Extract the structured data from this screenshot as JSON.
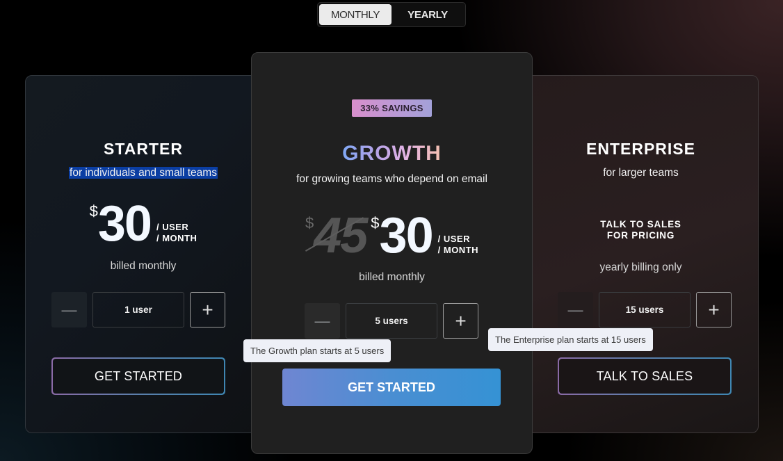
{
  "billing_toggle": {
    "options": [
      {
        "label": "MONTHLY",
        "active": true
      },
      {
        "label": "YEARLY",
        "active": false
      }
    ]
  },
  "plans": {
    "starter": {
      "title": "STARTER",
      "subtitle": "for individuals and small teams",
      "currency": "$",
      "price": "30",
      "per_user": "/ USER",
      "per_month": "/ MONTH",
      "billing": "billed monthly",
      "minus": "—",
      "plus": "+",
      "seats": "1 user",
      "cta": "GET STARTED"
    },
    "growth": {
      "badge": "33% SAVINGS",
      "title": "GROWTH",
      "subtitle": "for growing teams who depend on email",
      "currency": "$",
      "old_price": "45",
      "price": "30",
      "per_user": "/ USER",
      "per_month": "/ MONTH",
      "billing": "billed monthly",
      "minus": "—",
      "plus": "+",
      "seats": "5 users",
      "cta": "GET STARTED",
      "tooltip": "The Growth plan starts at 5 users"
    },
    "enterprise": {
      "title": "ENTERPRISE",
      "subtitle": "for larger teams",
      "pricing_line1": "TALK TO SALES",
      "pricing_line2": "FOR PRICING",
      "billing": "yearly billing only",
      "minus": "—",
      "plus": "+",
      "seats": "15 users",
      "cta": "TALK TO SALES",
      "tooltip": "The Enterprise plan starts at 15 users"
    }
  },
  "colors": {
    "highlight": "#0b3ea3",
    "cta_gradient_start": "#6f86d2",
    "cta_gradient_end": "#3592d4",
    "badge_gradient_start": "#d98fcc",
    "badge_gradient_end": "#a3a1d9"
  }
}
